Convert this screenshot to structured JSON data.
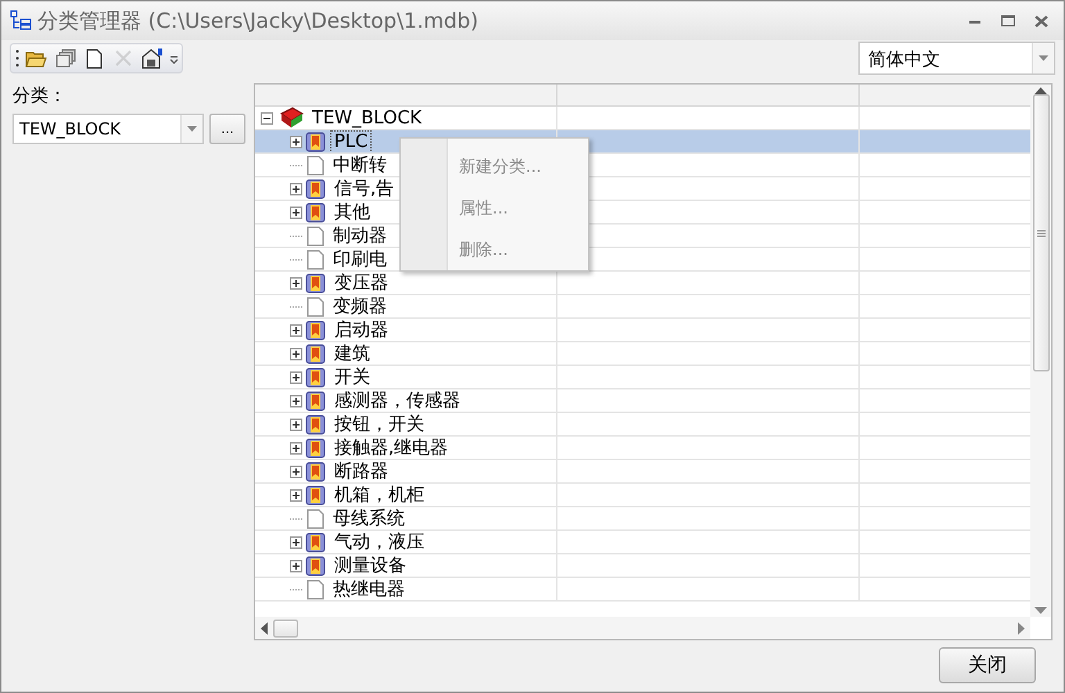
{
  "window": {
    "title": "分类管理器 (C:\\Users\\Jacky\\Desktop\\1.mdb)"
  },
  "toolbar": {
    "buttons": [
      {
        "kind": "open",
        "disabled": false
      },
      {
        "kind": "copy",
        "disabled": false
      },
      {
        "kind": "new",
        "disabled": false
      },
      {
        "kind": "delete",
        "disabled": true
      },
      {
        "kind": "properties",
        "disabled": false
      }
    ]
  },
  "language": {
    "value": "简体中文"
  },
  "category": {
    "label": "分类：",
    "value": "TEW_BLOCK",
    "browse": "..."
  },
  "tree": {
    "root": {
      "label": "TEW_BLOCK",
      "expanded": true,
      "selected": false,
      "children": [
        {
          "label": "PLC",
          "kind": "folder",
          "selected": true
        },
        {
          "label": "中断转",
          "kind": "leaf",
          "selected": false
        },
        {
          "label": "信号,告",
          "kind": "folder",
          "selected": false
        },
        {
          "label": "其他",
          "kind": "folder",
          "selected": false
        },
        {
          "label": "制动器",
          "kind": "leaf",
          "selected": false
        },
        {
          "label": "印刷电",
          "kind": "leaf",
          "selected": false
        },
        {
          "label": "变压器",
          "kind": "folder",
          "selected": false
        },
        {
          "label": "变频器",
          "kind": "leaf",
          "selected": false
        },
        {
          "label": "启动器",
          "kind": "folder",
          "selected": false
        },
        {
          "label": "建筑",
          "kind": "folder",
          "selected": false
        },
        {
          "label": "开关",
          "kind": "folder",
          "selected": false
        },
        {
          "label": "感测器，传感器",
          "kind": "folder",
          "selected": false
        },
        {
          "label": "按钮，开关",
          "kind": "folder",
          "selected": false
        },
        {
          "label": "接触器,继电器",
          "kind": "folder",
          "selected": false
        },
        {
          "label": "断路器",
          "kind": "folder",
          "selected": false
        },
        {
          "label": "机箱，机柜",
          "kind": "folder",
          "selected": false
        },
        {
          "label": "母线系统",
          "kind": "leaf",
          "selected": false
        },
        {
          "label": "气动，液压",
          "kind": "folder",
          "selected": false
        },
        {
          "label": "测量设备",
          "kind": "folder",
          "selected": false
        },
        {
          "label": "热继电器",
          "kind": "leaf",
          "selected": false
        }
      ]
    }
  },
  "context_menu": {
    "items": [
      {
        "label": "新建分类...",
        "disabled": true
      },
      {
        "label": "属性...",
        "disabled": true
      },
      {
        "label": "删除...",
        "disabled": true
      }
    ]
  },
  "buttons": [
    {
      "label": "关闭"
    }
  ]
}
